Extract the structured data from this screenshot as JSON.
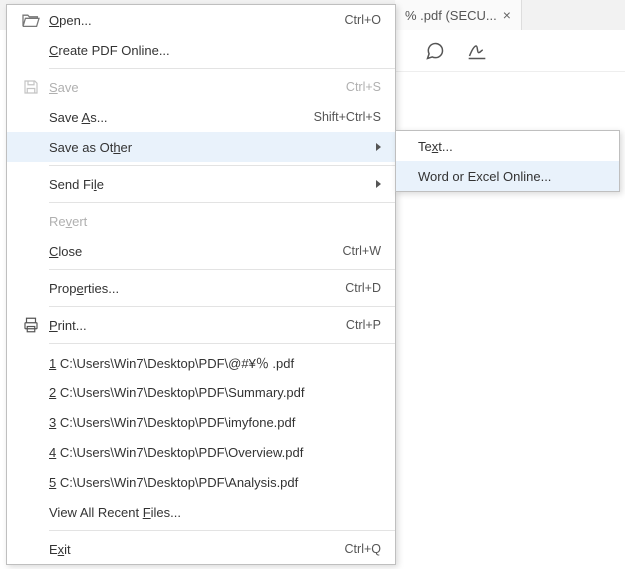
{
  "tab": {
    "label": "% .pdf (SECU...",
    "close": "×"
  },
  "menu": {
    "open": {
      "pre": "",
      "hot": "O",
      "post": "pen...",
      "sc": "Ctrl+O"
    },
    "create_online": {
      "pre": "",
      "hot": "C",
      "post": "reate PDF Online...",
      "sc": ""
    },
    "save": {
      "pre": "",
      "hot": "S",
      "post": "ave",
      "sc": "Ctrl+S"
    },
    "save_as": {
      "pre": "Save ",
      "hot": "A",
      "post": "s...",
      "sc": "Shift+Ctrl+S"
    },
    "save_other": {
      "pre": "Save as Ot",
      "hot": "h",
      "post": "er",
      "sc": ""
    },
    "send_file": {
      "pre": "Send Fi",
      "hot": "l",
      "post": "e",
      "sc": ""
    },
    "revert": {
      "pre": "Re",
      "hot": "v",
      "post": "ert",
      "sc": ""
    },
    "close": {
      "pre": "",
      "hot": "C",
      "post": "lose",
      "sc": "Ctrl+W"
    },
    "properties": {
      "pre": "Prop",
      "hot": "e",
      "post": "rties...",
      "sc": "Ctrl+D"
    },
    "print": {
      "pre": "",
      "hot": "P",
      "post": "rint...",
      "sc": "Ctrl+P"
    },
    "recent": [
      {
        "hot": "1",
        "path": " C:\\Users\\Win7\\Desktop\\PDF\\@#¥％ .pdf"
      },
      {
        "hot": "2",
        "path": " C:\\Users\\Win7\\Desktop\\PDF\\Summary.pdf"
      },
      {
        "hot": "3",
        "path": " C:\\Users\\Win7\\Desktop\\PDF\\imyfone.pdf"
      },
      {
        "hot": "4",
        "path": " C:\\Users\\Win7\\Desktop\\PDF\\Overview.pdf"
      },
      {
        "hot": "5",
        "path": " C:\\Users\\Win7\\Desktop\\PDF\\Analysis.pdf"
      }
    ],
    "view_recent": {
      "pre": "View All Recent ",
      "hot": "F",
      "post": "iles...",
      "sc": ""
    },
    "exit": {
      "pre": "E",
      "hot": "x",
      "post": "it",
      "sc": "Ctrl+Q"
    }
  },
  "submenu": {
    "text": {
      "pre": "Te",
      "hot": "x",
      "post": "t..."
    },
    "online": {
      "label": "Word or Excel Online..."
    }
  }
}
